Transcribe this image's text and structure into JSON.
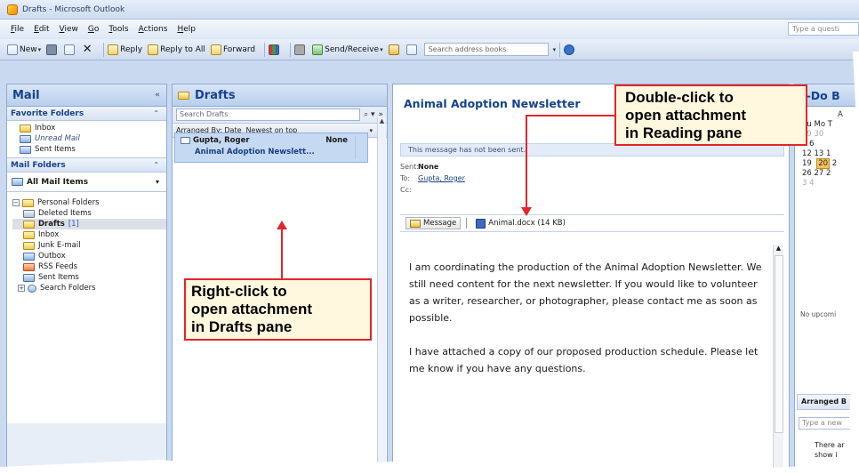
{
  "window": {
    "title": "Drafts - Microsoft Outlook"
  },
  "menu": [
    "File",
    "Edit",
    "View",
    "Go",
    "Tools",
    "Actions",
    "Help"
  ],
  "ask_box": {
    "placeholder": "Type a questi"
  },
  "toolbar": {
    "new_label": "New",
    "reply_label": "Reply",
    "reply_all_label": "Reply to All",
    "forward_label": "Forward",
    "send_receive_label": "Send/Receive",
    "search_address_books": "Search address books"
  },
  "nav": {
    "title": "Mail",
    "collapse": "«",
    "favorites_title": "Favorite Folders",
    "favorites": [
      {
        "label": "Inbox",
        "italic": false
      },
      {
        "label": "Unread Mail",
        "italic": true
      },
      {
        "label": "Sent Items",
        "italic": false
      }
    ],
    "mail_folders_title": "Mail Folders",
    "all_mail_items": "All Mail Items",
    "personal_folders": "Personal Folders",
    "folders": [
      {
        "label": "Deleted Items",
        "count": ""
      },
      {
        "label": "Drafts",
        "count": "[1]"
      },
      {
        "label": "Inbox",
        "count": ""
      },
      {
        "label": "Junk E-mail",
        "count": ""
      },
      {
        "label": "Outbox",
        "count": ""
      },
      {
        "label": "RSS Feeds",
        "count": ""
      },
      {
        "label": "Sent Items",
        "count": ""
      }
    ],
    "search_folders": "Search Folders"
  },
  "drafts": {
    "title": "Drafts",
    "search_placeholder": "Search Drafts",
    "arranged_by": "Arranged By: Date",
    "sort_order": "Newest on top",
    "message": {
      "sender": "Gupta, Roger",
      "date": "None",
      "subject": "Animal Adoption Newslett..."
    }
  },
  "reading": {
    "subject": "Animal Adoption Newsletter",
    "info_bar": "This message has not been sent.",
    "sent_label": "Sent:",
    "sent_value": "None",
    "to_label": "To:",
    "to_value": "Gupta, Roger",
    "cc_label": "Cc:",
    "message_tab": "Message",
    "attachment": "Animal.docx (14 KB)",
    "body": [
      "I am coordinating the production of the Animal Adoption Newsletter. We still need content for the next newsletter. If you would like to volunteer as a writer, researcher, or photographer, please contact me as soon as possible.",
      "I have attached a copy of our proposed production schedule. Please let me know if you have any questions."
    ]
  },
  "todo": {
    "title": "o-Do B",
    "month_letter": "A",
    "day_header": "Su Mo T",
    "weeks": [
      "29  30",
      "5   6",
      "12  13  1",
      "19  20  2",
      "26  27  2",
      "3   4"
    ],
    "today": "20",
    "no_upcoming": "No upcomi",
    "arranged": "Arranged B",
    "new_task_placeholder": "Type a new",
    "empty_line1": "There ar",
    "empty_line2": "show i"
  },
  "callouts": {
    "right_click": [
      "Right-click to",
      "open attachment",
      "in Drafts pane"
    ],
    "double_click": [
      "Double-click to",
      "open attachment",
      "in Reading pane"
    ]
  },
  "colors": {
    "callout_border": "#e2262a",
    "callout_bg": "#fff8de",
    "pane_header_text": "#15428b",
    "selected_row": "#c5d9f2"
  }
}
